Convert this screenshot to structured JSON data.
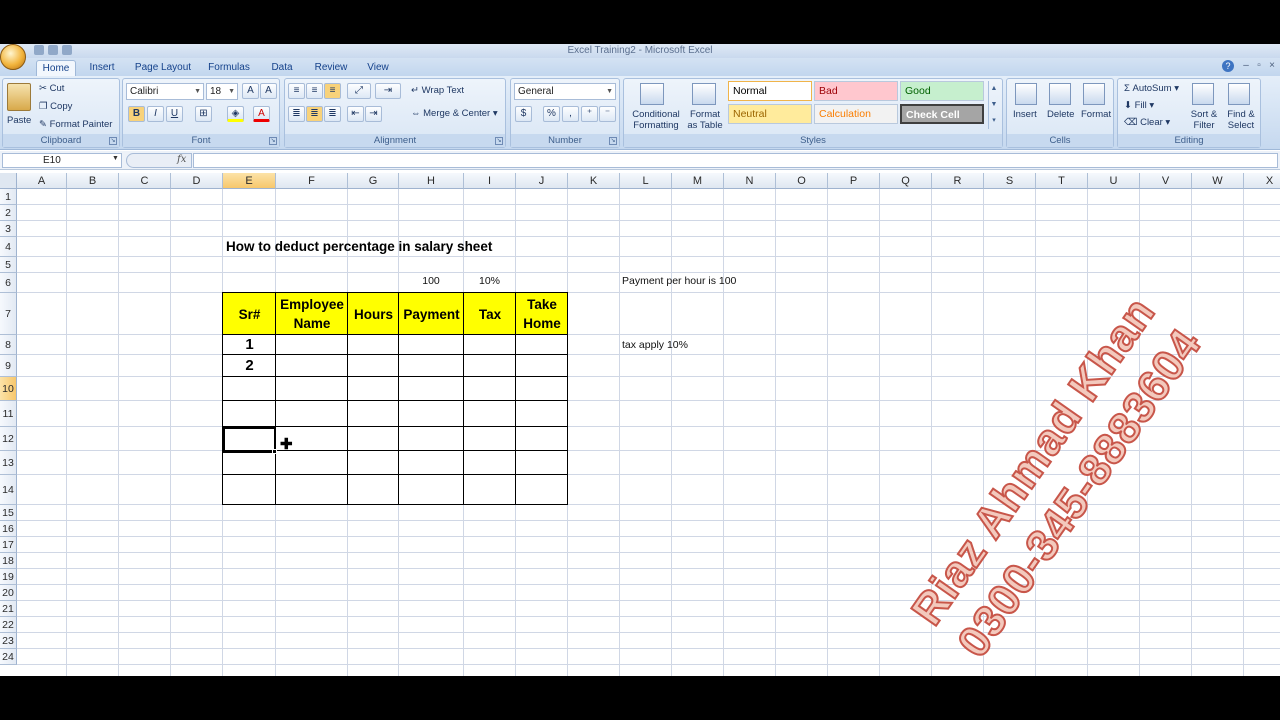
{
  "window": {
    "title": "Excel Training2 - Microsoft Excel"
  },
  "tabs": [
    "Home",
    "Insert",
    "Page Layout",
    "Formulas",
    "Data",
    "Review",
    "View"
  ],
  "active_tab": "Home",
  "ribbon": {
    "clipboard": {
      "label": "Clipboard",
      "paste": "Paste",
      "cut": "Cut",
      "copy": "Copy",
      "format_painter": "Format Painter"
    },
    "font": {
      "label": "Font",
      "font_name": "Calibri",
      "font_size": "18",
      "bold": "B",
      "italic": "I",
      "underline": "U"
    },
    "alignment": {
      "label": "Alignment",
      "wrap_text": "Wrap Text",
      "merge_center": "Merge & Center"
    },
    "number": {
      "label": "Number",
      "format": "General",
      "currency": "$",
      "percent": "%",
      "comma": ","
    },
    "styles": {
      "label": "Styles",
      "conditional": "Conditional Formatting",
      "format_table": "Format as Table",
      "cells": [
        {
          "name": "Normal",
          "bg": "#ffffff",
          "fg": "#000000"
        },
        {
          "name": "Bad",
          "bg": "#ffc7ce",
          "fg": "#9c0006"
        },
        {
          "name": "Good",
          "bg": "#c6efce",
          "fg": "#006100"
        },
        {
          "name": "Neutral",
          "bg": "#ffeb9c",
          "fg": "#9c6500"
        },
        {
          "name": "Calculation",
          "bg": "#f2f2f2",
          "fg": "#fa7d00"
        },
        {
          "name": "Check Cell",
          "bg": "#a5a5a5",
          "fg": "#ffffff"
        }
      ]
    },
    "cells_group": {
      "label": "Cells",
      "insert": "Insert",
      "delete": "Delete",
      "format": "Format"
    },
    "editing": {
      "label": "Editing",
      "autosum": "AutoSum",
      "fill": "Fill",
      "clear": "Clear",
      "sort_filter": "Sort & Filter",
      "find_select": "Find & Select"
    }
  },
  "formula_bar": {
    "name_box": "E10",
    "fx": "fx",
    "value": ""
  },
  "columns": [
    "A",
    "B",
    "C",
    "D",
    "E",
    "F",
    "G",
    "H",
    "I",
    "J",
    "K",
    "L",
    "M",
    "N",
    "O",
    "P",
    "Q",
    "R",
    "S",
    "T",
    "U",
    "V",
    "W",
    "X"
  ],
  "rows": [
    "1",
    "2",
    "3",
    "4",
    "5",
    "6",
    "7",
    "8",
    "9",
    "10",
    "11",
    "12",
    "13",
    "14",
    "15",
    "16",
    "17",
    "18",
    "19",
    "20",
    "21",
    "22",
    "23",
    "24"
  ],
  "selected_cell": "E10",
  "sheet": {
    "title": "How to deduct percentage in salary sheet",
    "rate_payment": "100",
    "rate_tax": "10%",
    "table_headers": [
      "Sr#",
      "Employee Name",
      "Hours",
      "Payment",
      "Tax",
      "Take Home"
    ],
    "sr_values": [
      "1",
      "2"
    ],
    "note1": "Payment per hour is 100",
    "note2": "tax apply 10%"
  },
  "watermark": {
    "line1": "Riaz Ahmad Khan",
    "line2": "0300-345-8883604"
  }
}
